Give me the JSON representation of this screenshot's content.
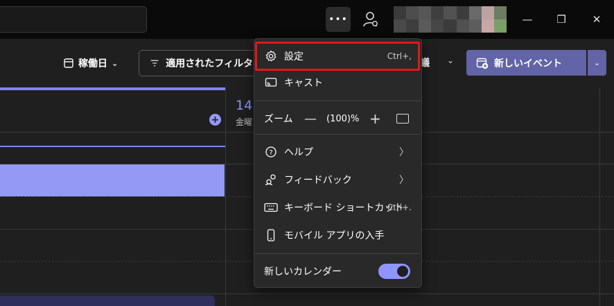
{
  "titlebar": {
    "more_label": "•••",
    "minimize_label": "—",
    "restore_label": "❐",
    "close_label": "✕",
    "avatar_colors": [
      "#3a3a3a",
      "#4d4d4d",
      "#575757",
      "#3f3f3f",
      "#525252",
      "#3d3d3d",
      "#6a6a6a",
      "#bca3a3",
      "#6d7c62",
      "#4a4a4a",
      "#3e3e3e",
      "#5b5b5b",
      "#464646",
      "#3b3b3b",
      "#505050",
      "#5d5d5d",
      "#c9a7a7",
      "#7aa06a"
    ]
  },
  "toolbar": {
    "workweek_label": "稼働日",
    "filter_label": "適用されたフィルター",
    "meeting_tail": "議",
    "new_event_label": "新しいイベント"
  },
  "calendar": {
    "day_number": "14",
    "day_name": "金曜"
  },
  "menu": {
    "settings_label": "設定",
    "settings_shortcut": "Ctrl+,",
    "cast_label": "キャスト",
    "zoom_label": "ズーム",
    "zoom_minus": "—",
    "zoom_value": "(100)%",
    "zoom_plus": "+",
    "help_label": "ヘルプ",
    "feedback_label": "フィードバック",
    "keyboard_label": "キーボード ショートカット",
    "keyboard_shortcut": "Ctrl+.",
    "mobile_label": "モバイル アプリの入手",
    "new_calendar_label": "新しいカレンダー",
    "new_calendar_on": true
  },
  "colors": {
    "accent": "#6264a7",
    "accent_light": "#8f95ff",
    "highlight": "#e21818"
  }
}
